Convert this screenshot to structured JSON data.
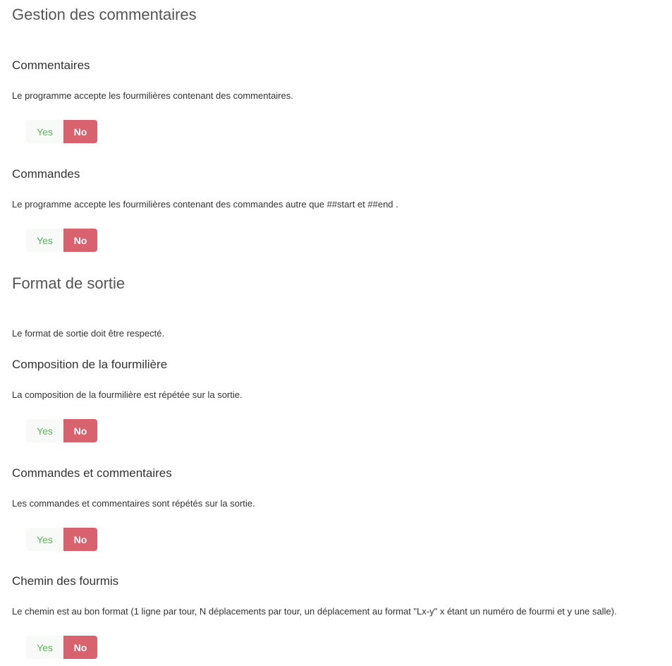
{
  "sections": [
    {
      "title": "Gestion des commentaires",
      "questions": [
        {
          "title": "Commentaires",
          "description": "Le programme accepte les fourmilières contenant des commentaires.",
          "yes_label": "Yes",
          "no_label": "No",
          "selected": "No"
        },
        {
          "title": "Commandes",
          "description": "Le programme accepte les fourmilières contenant des commandes autre que ##start et ##end .",
          "yes_label": "Yes",
          "no_label": "No",
          "selected": "No"
        }
      ]
    },
    {
      "title": "Format de sortie",
      "intro": "Le format de sortie doit être respecté.",
      "questions": [
        {
          "title": "Composition de la fourmilière",
          "description": "La composition de la fourmilière est répétée sur la sortie.",
          "yes_label": "Yes",
          "no_label": "No",
          "selected": "No"
        },
        {
          "title": "Commandes et commentaires",
          "description": "Les commandes et commentaires sont répétés sur la sortie.",
          "yes_label": "Yes",
          "no_label": "No",
          "selected": "No"
        },
        {
          "title": "Chemin des fourmis",
          "description": "Le chemin est au bon format (1 ligne par tour, N déplacements par tour, un déplacement au format \"Lx-y\" x étant un numéro de fourmi et y une salle).",
          "yes_label": "Yes",
          "no_label": "No",
          "selected": "No"
        }
      ]
    }
  ],
  "colors": {
    "yes_text": "#5cb85c",
    "yes_background": "#f7faf6",
    "no_background": "#d9626f",
    "no_text": "#ffffff"
  }
}
